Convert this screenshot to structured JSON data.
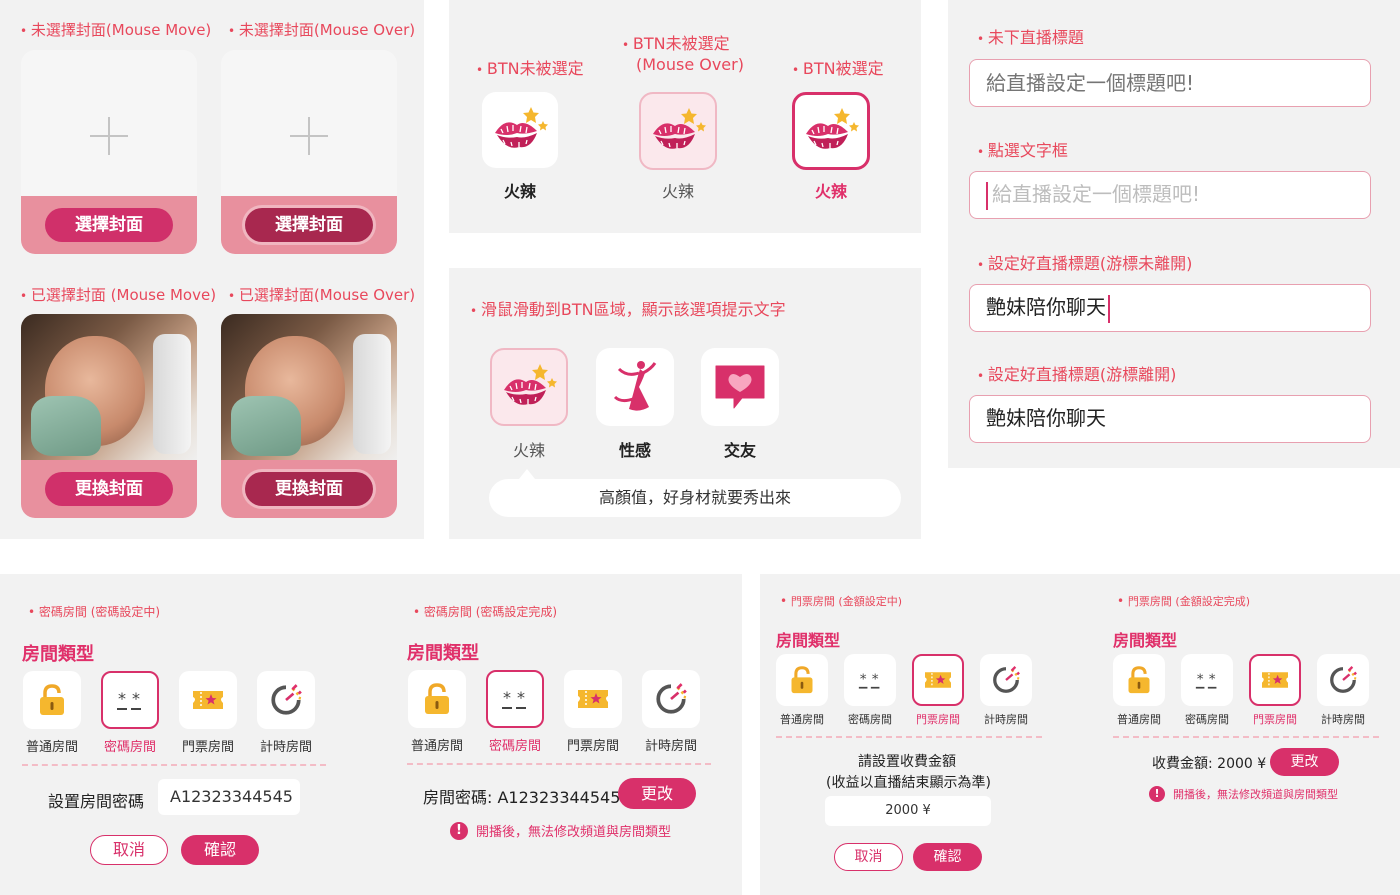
{
  "covers": {
    "label_unselected_move": "未選擇封面(Mouse Move)",
    "label_unselected_over": "未選擇封面(Mouse Over)",
    "label_selected_move": "已選擇封面 (Mouse Move)",
    "label_selected_over": "已選擇封面(Mouse Over)",
    "choose_btn": "選擇封面",
    "change_btn": "更換封面"
  },
  "btn_states": {
    "label_unselected": "BTN未被選定",
    "label_hover_line1": "BTN未被選定",
    "label_hover_line2": "(Mouse Over)",
    "label_selected": "BTN被選定",
    "caption": "火辣"
  },
  "tooltip_demo": {
    "label": "滑鼠滑動到BTN區域，顯示該選項提示文字",
    "items": [
      "火辣",
      "性感",
      "交友"
    ],
    "tooltip": "高顏值，好身材就要秀出來"
  },
  "title_inputs": {
    "label_empty": "未下直播標題",
    "label_focus": "點選文字框",
    "label_set_focus": "設定好直播標題(游標未離開)",
    "label_set_blur": "設定好直播標題(游標離開)",
    "placeholder": "給直播設定一個標題吧!",
    "value": "艶妹陪你聊天"
  },
  "room": {
    "title": "房間類型",
    "types": [
      "普通房間",
      "密碼房間",
      "門票房間",
      "計時房間"
    ],
    "pw_setting_label": "密碼房間 (密碼設定中)",
    "pw_done_label": "密碼房間 (密碼設定完成)",
    "pw_field_label": "設置房間密碼",
    "pw_value": "A12323344545",
    "pw_done_text": "房間密碼: A12323344545",
    "cancel": "取消",
    "confirm": "確認",
    "change": "更改",
    "warning": "開播後，無法修改頻道與房間類型",
    "ticket_setting_label": "門票房間 (金額設定中)",
    "ticket_done_label": "門票房間 (金額設定完成)",
    "ticket_prompt_line1": "請設置收費金額",
    "ticket_prompt_line2": "(收益以直播結束顯示為準)",
    "ticket_value": "2000 ¥",
    "ticket_done_text": "收費金額: 2000 ¥"
  }
}
